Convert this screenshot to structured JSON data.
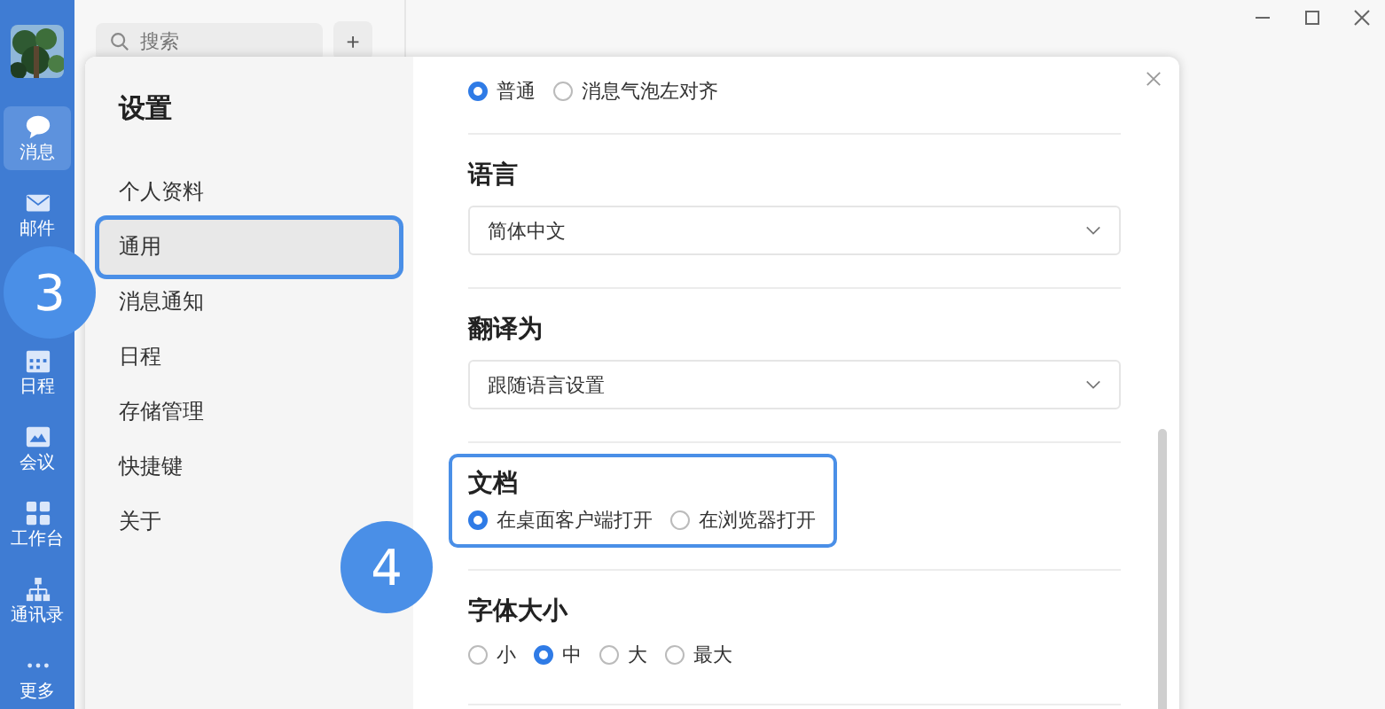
{
  "rail": {
    "items": [
      {
        "label": "消息",
        "kind": "chat",
        "selected": true
      },
      {
        "label": "邮件",
        "kind": "mail",
        "selected": false
      },
      {
        "label": "日程",
        "kind": "calendar",
        "selected": false
      },
      {
        "label": "会议",
        "kind": "meeting",
        "selected": false
      },
      {
        "label": "工作台",
        "kind": "grid",
        "selected": false
      },
      {
        "label": "通讯录",
        "kind": "org",
        "selected": false
      },
      {
        "label": "更多",
        "kind": "more",
        "selected": false
      }
    ]
  },
  "search": {
    "placeholder": "搜索"
  },
  "add_button": "+",
  "dialog": {
    "title": "设置",
    "nav": [
      {
        "label": "个人资料",
        "selected": false
      },
      {
        "label": "通用",
        "selected": true
      },
      {
        "label": "消息通知",
        "selected": false
      },
      {
        "label": "日程",
        "selected": false
      },
      {
        "label": "存储管理",
        "selected": false
      },
      {
        "label": "快捷键",
        "selected": false
      },
      {
        "label": "关于",
        "selected": false
      }
    ],
    "sections": [
      {
        "kind": "radio",
        "options": [
          {
            "label": "普通",
            "selected": true
          },
          {
            "label": "消息气泡左对齐",
            "selected": false
          }
        ]
      },
      {
        "kind": "select",
        "title": "语言",
        "value": "简体中文"
      },
      {
        "kind": "select",
        "title": "翻译为",
        "value": "跟随语言设置"
      },
      {
        "kind": "radio",
        "title": "文档",
        "highlighted": true,
        "options": [
          {
            "label": "在桌面客户端打开",
            "selected": true
          },
          {
            "label": "在浏览器打开",
            "selected": false
          }
        ]
      },
      {
        "kind": "radio",
        "title": "字体大小",
        "options": [
          {
            "label": "小",
            "selected": false
          },
          {
            "label": "中",
            "selected": true
          },
          {
            "label": "大",
            "selected": false
          },
          {
            "label": "最大",
            "selected": false
          }
        ]
      }
    ]
  },
  "callouts": [
    {
      "label": "3"
    },
    {
      "label": "4"
    }
  ]
}
